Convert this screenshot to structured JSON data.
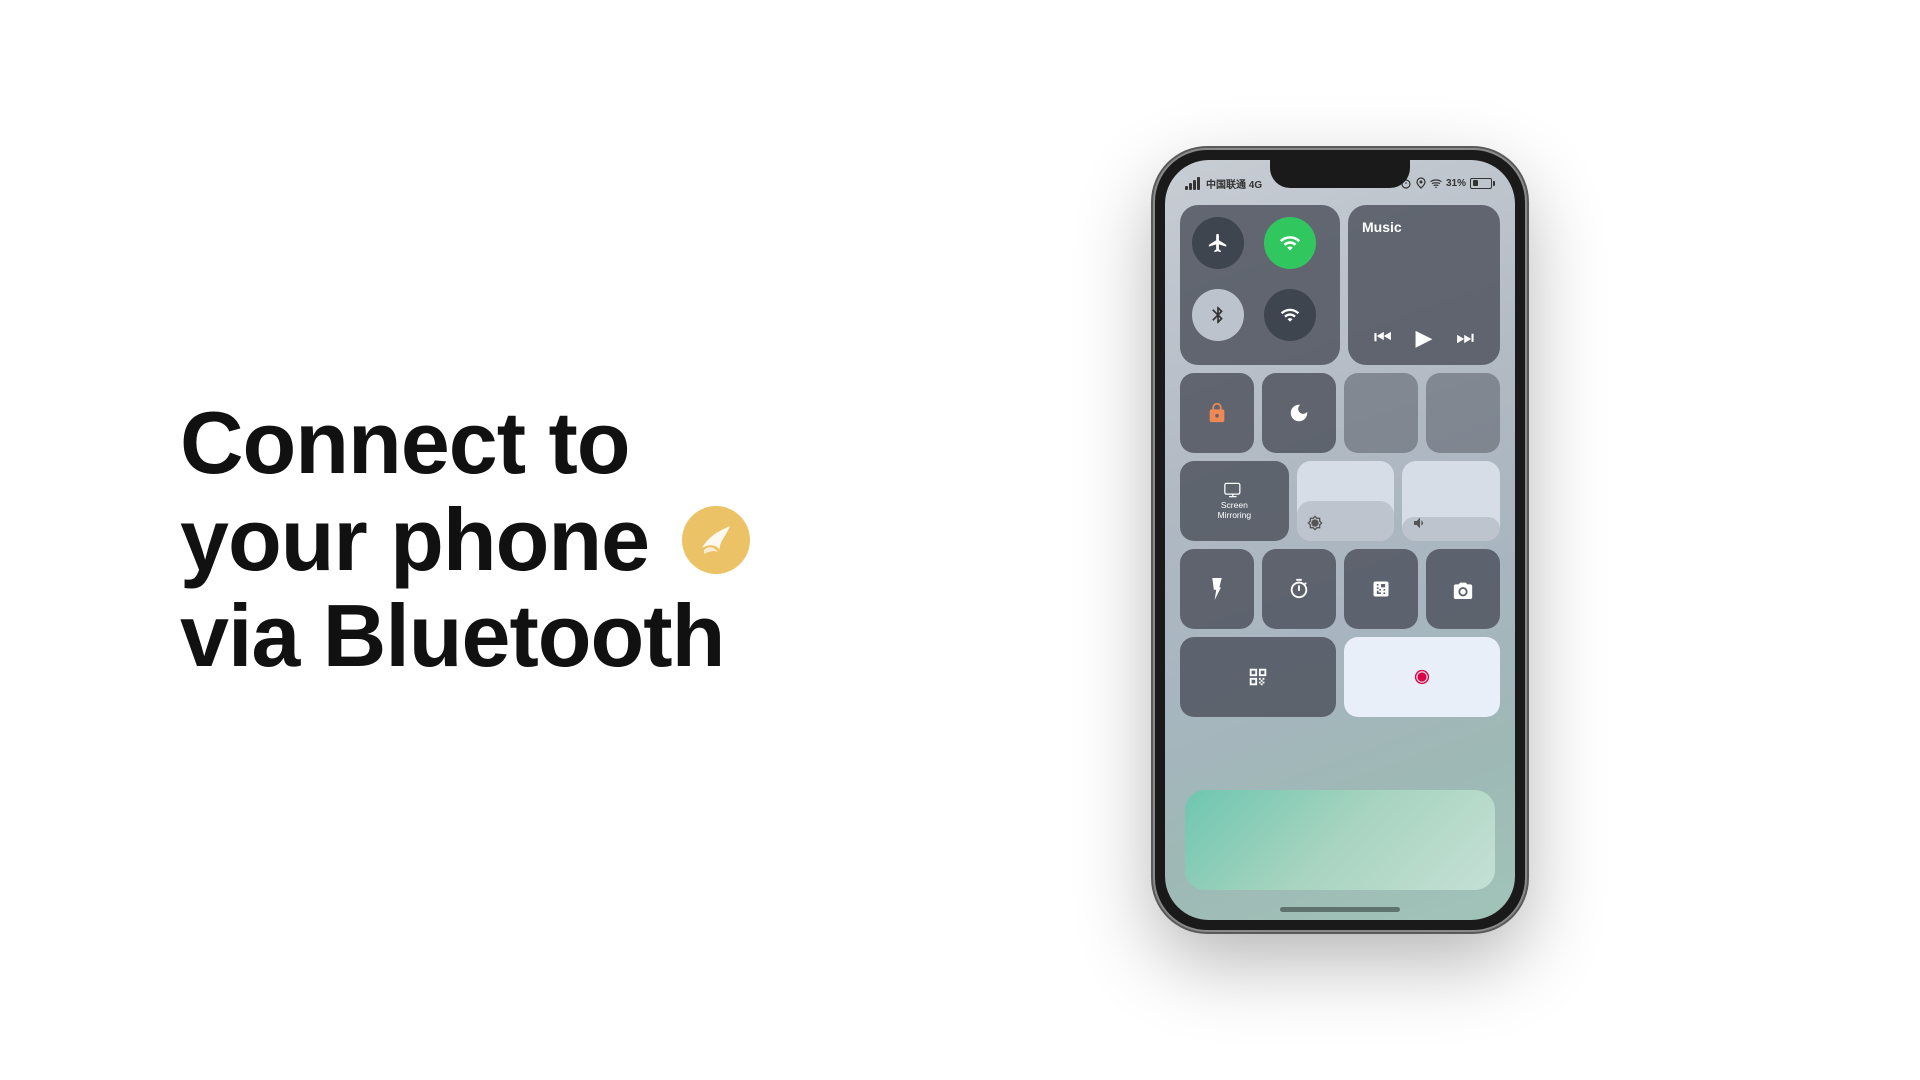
{
  "heading": {
    "line1": "Connect to",
    "line2": "your phone",
    "line3": "via Bluetooth"
  },
  "phone": {
    "status": {
      "carrier": "中国联通 4G",
      "battery": "31%",
      "signal_bars": [
        4,
        7,
        10,
        13
      ]
    },
    "control_center": {
      "connectivity": {
        "airplane_mode": "✈",
        "wifi_active": "📶",
        "wifi_label": "WiFi",
        "bluetooth_label": "Bluetooth",
        "airplane_label": "Airplane"
      },
      "music": {
        "title": "Music",
        "prev": "⏮",
        "play": "▶",
        "next": "⏭"
      },
      "icons": {
        "lock_rotation": "🔒",
        "do_not_disturb": "🌙",
        "slider1": "☀",
        "slider2": "🔊",
        "screen_mirror": "Screen\nMirroring",
        "flashlight": "🔦",
        "timer": "⏱",
        "calculator": "🔢",
        "camera": "📷",
        "qr_code": "▦",
        "record": "⏺"
      }
    }
  },
  "swift_icon": {
    "color": "#E8B84B"
  }
}
